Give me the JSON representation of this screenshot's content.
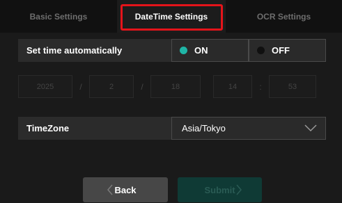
{
  "tabs": [
    {
      "label": "Basic Settings",
      "active": false
    },
    {
      "label": "DateTime Settings",
      "active": true
    },
    {
      "label": "OCR Settings",
      "active": false
    }
  ],
  "auto_time": {
    "label": "Set time automatically",
    "on_label": "ON",
    "off_label": "OFF",
    "selected": "ON"
  },
  "datetime": {
    "year": "2025",
    "month": "2",
    "day": "18",
    "hour": "14",
    "minute": "53",
    "date_separator": "/",
    "time_separator": ":"
  },
  "timezone": {
    "label": "TimeZone",
    "value": "Asia/Tokyo"
  },
  "buttons": {
    "back": "Back",
    "submit": "Submit"
  },
  "colors": {
    "accent": "#1fb5a6",
    "highlight": "#e4141a",
    "submit_disabled": "#0f3a35"
  },
  "icons": {
    "back": "chevron-left-icon",
    "submit": "chevron-right-icon",
    "timezone_dropdown": "chevron-down-icon"
  }
}
